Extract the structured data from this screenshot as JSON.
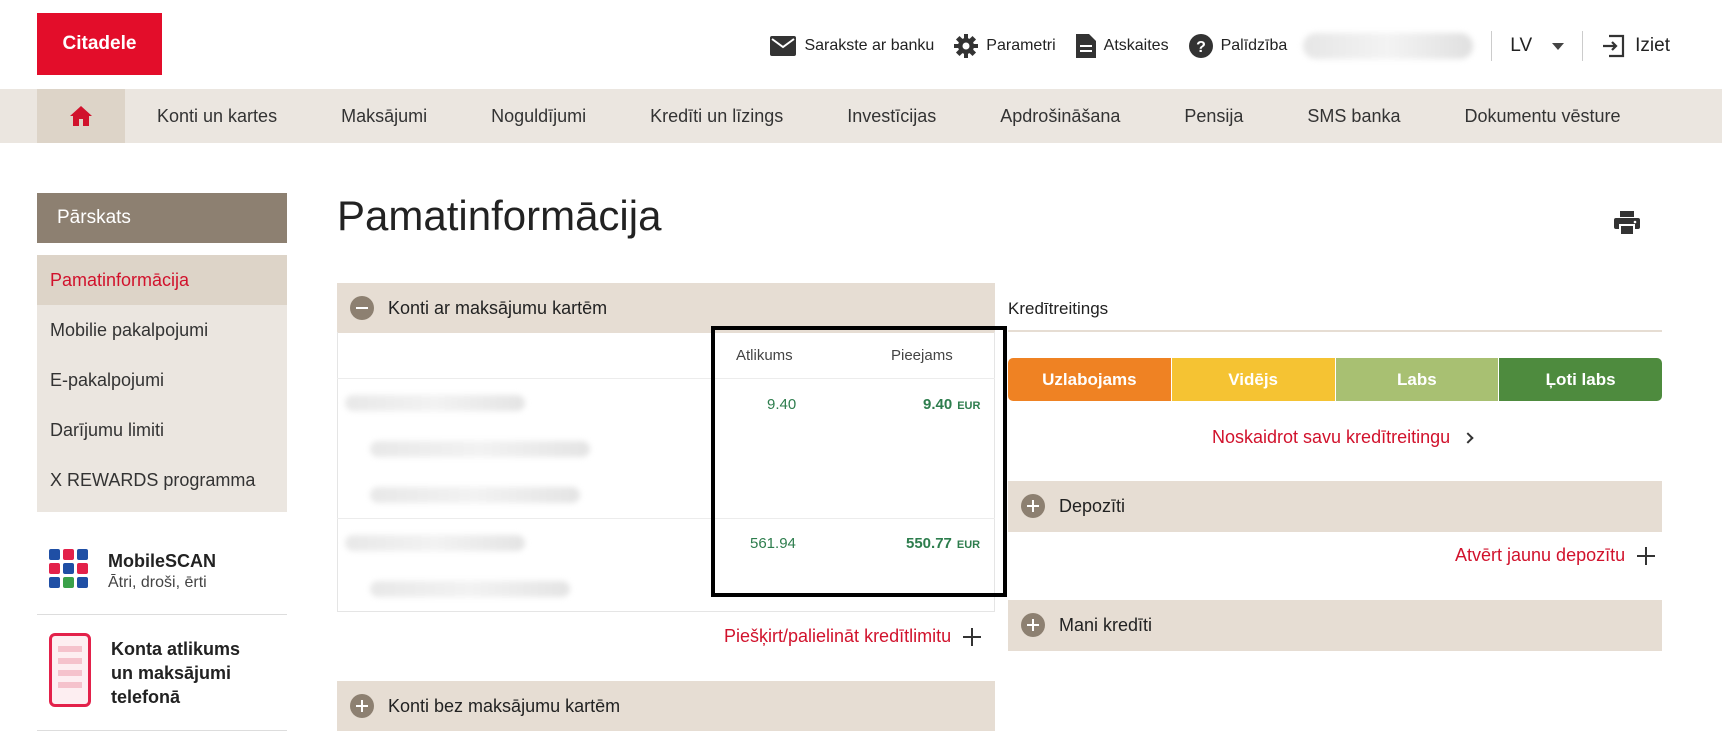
{
  "brand": {
    "logo_text": "Citadele",
    "accent": "#e30d2a"
  },
  "top_links": {
    "messages": "Sarakste ar banku",
    "settings": "Parametri",
    "reports": "Atskaites",
    "help": "Palīdzība",
    "language": "LV",
    "logout": "Iziet"
  },
  "nav": {
    "items": [
      "Konti un kartes",
      "Maksājumi",
      "Noguldījumi",
      "Kredīti un līzings",
      "Investīcijas",
      "Apdrošināšana",
      "Pensija",
      "SMS banka",
      "Dokumentu vēsture"
    ]
  },
  "sidebar": {
    "header": "Pārskats",
    "items": [
      {
        "label": "Pamatinformācija"
      },
      {
        "label": "Mobilie pakalpojumi"
      },
      {
        "label": "E-pakalpojumi"
      },
      {
        "label": "Darījumu limiti"
      },
      {
        "label": "X REWARDS programma"
      }
    ],
    "promo_mobilescan": {
      "title": "MobileSCAN",
      "subtitle": "Ātri, droši, ērti"
    },
    "promo_phone": {
      "title_lines": [
        "Konta atlikums",
        "un maksājumi",
        "telefonā"
      ]
    }
  },
  "main": {
    "title": "Pamatinformācija",
    "accounts_with_cards": {
      "header": "Konti ar maksājumu kartēm",
      "col_balance": "Atlikums",
      "col_available": "Pieejams",
      "rows": [
        {
          "balance": "9.40",
          "available": "9.40",
          "currency": "EUR"
        },
        {
          "balance": "561.94",
          "available": "550.77",
          "currency": "EUR"
        }
      ],
      "credit_limit_link": "Piešķirt/palielināt kredītlimitu"
    },
    "accounts_without_cards": {
      "header": "Konti bez maksājumu kartēm"
    }
  },
  "right": {
    "credit_rating_label": "Kredītreitings",
    "rating_levels": [
      {
        "label": "Uzlabojams",
        "color": "#ef8223"
      },
      {
        "label": "Vidējs",
        "color": "#f5c333"
      },
      {
        "label": "Labs",
        "color": "#a8c072"
      },
      {
        "label": "Ļoti labs",
        "color": "#4e8b3e"
      }
    ],
    "check_rating_link": "Noskaidrot savu kredītreitingu",
    "deposits_header": "Depozīti",
    "open_deposit_link": "Atvērt jaunu depozītu",
    "loans_header": "Mani kredīti"
  }
}
